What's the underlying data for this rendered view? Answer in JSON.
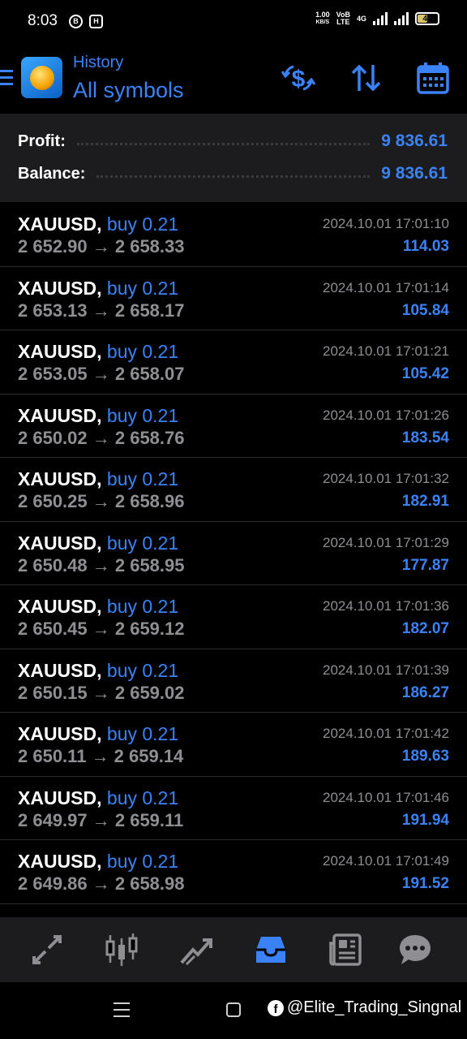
{
  "status_bar": {
    "time": "8:03",
    "badge_b": "B",
    "badge_h": "H",
    "net_speed_top": "1.00",
    "net_speed_bottom": "KB/S",
    "volte_top": "VoB",
    "volte_bottom": "LTE",
    "net_type": "4G",
    "battery": "46"
  },
  "header": {
    "subtitle": "History",
    "title": "All symbols"
  },
  "summary": {
    "profit_label": "Profit:",
    "profit_value": "9 836.61",
    "balance_label": "Balance:",
    "balance_value": "9 836.61"
  },
  "deals": [
    {
      "symbol": "XAUUSD,",
      "side": "buy 0.21",
      "prices": "2 652.90 → 2 658.33",
      "time": "2024.10.01 17:01:10",
      "profit": "114.03"
    },
    {
      "symbol": "XAUUSD,",
      "side": "buy 0.21",
      "prices": "2 653.13 → 2 658.17",
      "time": "2024.10.01 17:01:14",
      "profit": "105.84"
    },
    {
      "symbol": "XAUUSD,",
      "side": "buy 0.21",
      "prices": "2 653.05 → 2 658.07",
      "time": "2024.10.01 17:01:21",
      "profit": "105.42"
    },
    {
      "symbol": "XAUUSD,",
      "side": "buy 0.21",
      "prices": "2 650.02 → 2 658.76",
      "time": "2024.10.01 17:01:26",
      "profit": "183.54"
    },
    {
      "symbol": "XAUUSD,",
      "side": "buy 0.21",
      "prices": "2 650.25 → 2 658.96",
      "time": "2024.10.01 17:01:32",
      "profit": "182.91"
    },
    {
      "symbol": "XAUUSD,",
      "side": "buy 0.21",
      "prices": "2 650.48 → 2 658.95",
      "time": "2024.10.01 17:01:29",
      "profit": "177.87"
    },
    {
      "symbol": "XAUUSD,",
      "side": "buy 0.21",
      "prices": "2 650.45 → 2 659.12",
      "time": "2024.10.01 17:01:36",
      "profit": "182.07"
    },
    {
      "symbol": "XAUUSD,",
      "side": "buy 0.21",
      "prices": "2 650.15 → 2 659.02",
      "time": "2024.10.01 17:01:39",
      "profit": "186.27"
    },
    {
      "symbol": "XAUUSD,",
      "side": "buy 0.21",
      "prices": "2 650.11 → 2 659.14",
      "time": "2024.10.01 17:01:42",
      "profit": "189.63"
    },
    {
      "symbol": "XAUUSD,",
      "side": "buy 0.21",
      "prices": "2 649.97 → 2 659.11",
      "time": "2024.10.01 17:01:46",
      "profit": "191.94"
    },
    {
      "symbol": "XAUUSD,",
      "side": "buy 0.21",
      "prices": "2 649.86 → 2 658.98",
      "time": "2024.10.01 17:01:49",
      "profit": "191.52"
    }
  ],
  "watermark": {
    "text": "@Elite_Trading_Singnal",
    "fb_glyph": "f"
  },
  "icons": {
    "top_bar": [
      "currency-exchange-icon",
      "sort-icon",
      "calendar-icon"
    ],
    "bottom_nav": [
      "quotes-icon",
      "chart-icon",
      "trade-icon",
      "history-icon",
      "news-icon",
      "messages-icon"
    ]
  },
  "colors": {
    "accent": "#3b82f6",
    "background": "#000000",
    "panel": "#1c1c1e",
    "muted_text": "#8e8e93"
  }
}
